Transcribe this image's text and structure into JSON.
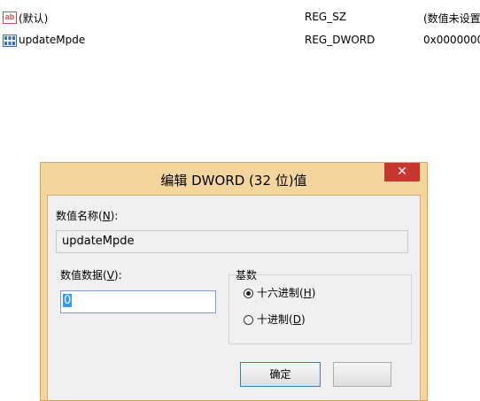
{
  "registry_list": {
    "rows": [
      {
        "icon": "string-value-icon",
        "icon_text": "ab",
        "name": "(默认)",
        "type": "REG_SZ",
        "data": "(数值未设置"
      },
      {
        "icon": "dword-value-icon",
        "name": "updateMpde",
        "type": "REG_DWORD",
        "data": "0x0000000"
      }
    ]
  },
  "dialog": {
    "title": "编辑 DWORD (32 位)值",
    "close_symbol": "✕",
    "value_name_label": "数值名称(",
    "value_name_key": "N",
    "value_name_suffix": "):",
    "value_name": "updateMpde",
    "value_data_label": "数值数据(",
    "value_data_key": "V",
    "value_data_suffix": "):",
    "value_data": "0",
    "base_label": "基数",
    "base_options": [
      {
        "label": "十六进制(",
        "key": "H",
        "suffix": ")",
        "selected": true
      },
      {
        "label": "十进制(",
        "key": "D",
        "suffix": ")",
        "selected": false
      }
    ],
    "ok_label": "确定"
  },
  "colors": {
    "title_bar": "#f4d59c",
    "close_button": "#c7362f",
    "dialog_background": "#f0f0f0"
  }
}
